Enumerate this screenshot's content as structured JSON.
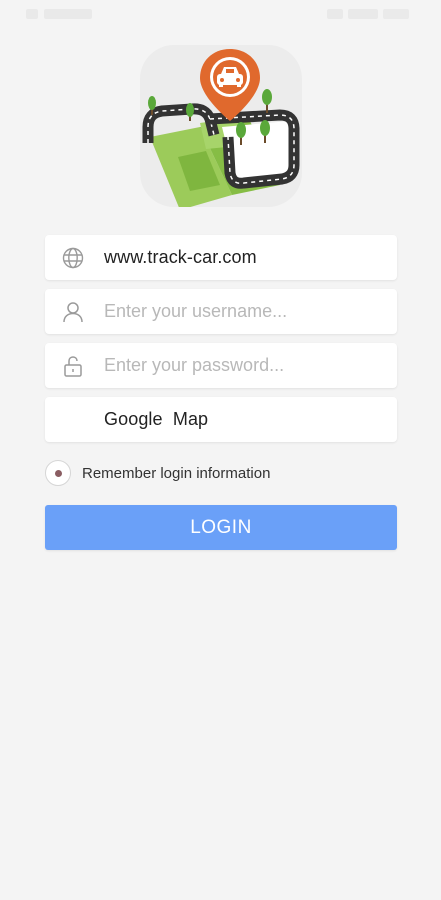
{
  "server": {
    "value": "www.track-car.com",
    "icon": "globe-icon"
  },
  "username": {
    "placeholder": "Enter your username...",
    "icon": "user-icon"
  },
  "password": {
    "placeholder": "Enter your password...",
    "icon": "lock-icon"
  },
  "map_select": {
    "value": "Google  Map"
  },
  "remember": {
    "label": "Remember login information",
    "checked": true
  },
  "login_button": {
    "label": "LOGIN"
  },
  "colors": {
    "background": "#f4f4f4",
    "accent": "#6aa0f8",
    "logo_pin": "#e0692d",
    "map_green": "#8cc04a"
  }
}
